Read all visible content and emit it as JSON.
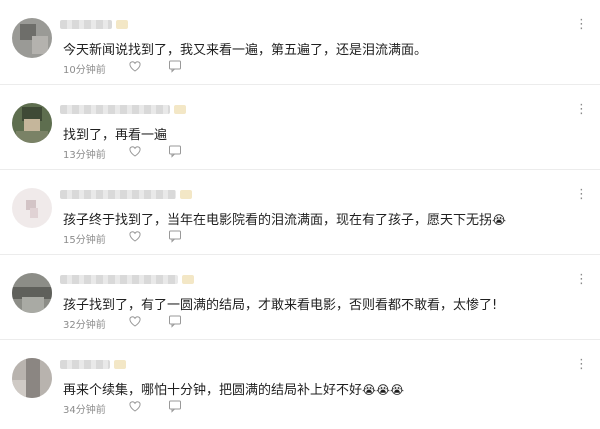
{
  "comments": [
    {
      "text": "今天新闻说找到了，我又来看一遍，第五遍了，还是泪流满面。",
      "time": "10分钟前",
      "emoji": "",
      "avatar_color": "#8a8a86"
    },
    {
      "text": "找到了，再看一遍",
      "time": "13分钟前",
      "emoji": "",
      "avatar_color": "#6b7a58"
    },
    {
      "text": "孩子终于找到了，当年在电影院看的泪流满面，现在有了孩子，愿天下无拐",
      "time": "15分钟前",
      "emoji": "😭",
      "avatar_color": "#e8dfe0"
    },
    {
      "text": "孩子找到了，有了一圆满的结局，才敢来看电影，否则看都不敢看，太惨了!",
      "time": "32分钟前",
      "emoji": "",
      "avatar_color": "#7d7e78"
    },
    {
      "text": "再来个续集，哪怕十分钟，把圆满的结局补上好不好",
      "time": "34分钟前",
      "emoji": "😭😭😭",
      "avatar_color": "#a39f9b"
    }
  ],
  "icons": {
    "more": "more-vertical-icon",
    "like": "heart-icon",
    "reply": "comment-icon"
  },
  "colors": {
    "text": "#1f1f1f",
    "meta": "#8c8c8c",
    "divider": "#ececec"
  }
}
